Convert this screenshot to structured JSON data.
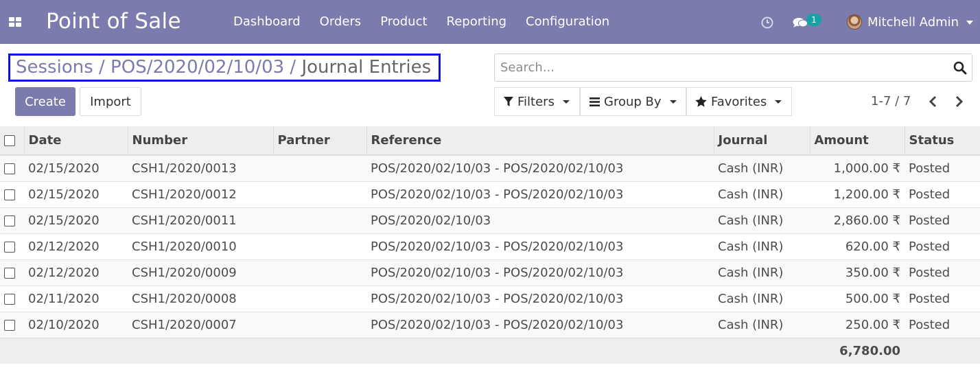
{
  "app": {
    "title": "Point of Sale"
  },
  "nav": {
    "menu": [
      "Dashboard",
      "Orders",
      "Product",
      "Reporting",
      "Configuration"
    ],
    "message_badge": "1",
    "user_name": "Mitchell Admin"
  },
  "breadcrumb": {
    "items": [
      "Sessions",
      "POS/2020/02/10/03",
      "Journal Entries"
    ],
    "separator": "/"
  },
  "buttons": {
    "create": "Create",
    "import": "Import"
  },
  "search": {
    "placeholder": "Search..."
  },
  "filters": {
    "filters": "Filters",
    "group_by": "Group By",
    "favorites": "Favorites"
  },
  "pager": {
    "value": "1-7 / 7"
  },
  "table": {
    "columns": [
      "Date",
      "Number",
      "Partner",
      "Reference",
      "Journal",
      "Amount",
      "Status"
    ],
    "rows": [
      {
        "date": "02/15/2020",
        "number": "CSH1/2020/0013",
        "partner": "",
        "reference": "POS/2020/02/10/03 - POS/2020/02/10/03",
        "journal": "Cash (INR)",
        "amount": "1,000.00 ₹",
        "status": "Posted"
      },
      {
        "date": "02/15/2020",
        "number": "CSH1/2020/0012",
        "partner": "",
        "reference": "POS/2020/02/10/03 - POS/2020/02/10/03",
        "journal": "Cash (INR)",
        "amount": "1,200.00 ₹",
        "status": "Posted"
      },
      {
        "date": "02/15/2020",
        "number": "CSH1/2020/0011",
        "partner": "",
        "reference": "POS/2020/02/10/03",
        "journal": "Cash (INR)",
        "amount": "2,860.00 ₹",
        "status": "Posted"
      },
      {
        "date": "02/12/2020",
        "number": "CSH1/2020/0010",
        "partner": "",
        "reference": "POS/2020/02/10/03 - POS/2020/02/10/03",
        "journal": "Cash (INR)",
        "amount": "620.00 ₹",
        "status": "Posted"
      },
      {
        "date": "02/12/2020",
        "number": "CSH1/2020/0009",
        "partner": "",
        "reference": "POS/2020/02/10/03 - POS/2020/02/10/03",
        "journal": "Cash (INR)",
        "amount": "350.00 ₹",
        "status": "Posted"
      },
      {
        "date": "02/11/2020",
        "number": "CSH1/2020/0008",
        "partner": "",
        "reference": "POS/2020/02/10/03 - POS/2020/02/10/03",
        "journal": "Cash (INR)",
        "amount": "500.00 ₹",
        "status": "Posted"
      },
      {
        "date": "02/10/2020",
        "number": "CSH1/2020/0007",
        "partner": "",
        "reference": "POS/2020/02/10/03 - POS/2020/02/10/03",
        "journal": "Cash (INR)",
        "amount": "250.00 ₹",
        "status": "Posted"
      }
    ],
    "total_amount": "6,780.00"
  },
  "icons": [
    "apps-grid-icon",
    "clock-icon",
    "chat-icon",
    "search-icon",
    "filter-icon",
    "group-by-icon",
    "star-icon",
    "chevron-left-icon",
    "chevron-right-icon"
  ],
  "colors": {
    "brand": "#7c7bad",
    "badge": "#17a2a8",
    "highlight_border": "#1010d8"
  }
}
